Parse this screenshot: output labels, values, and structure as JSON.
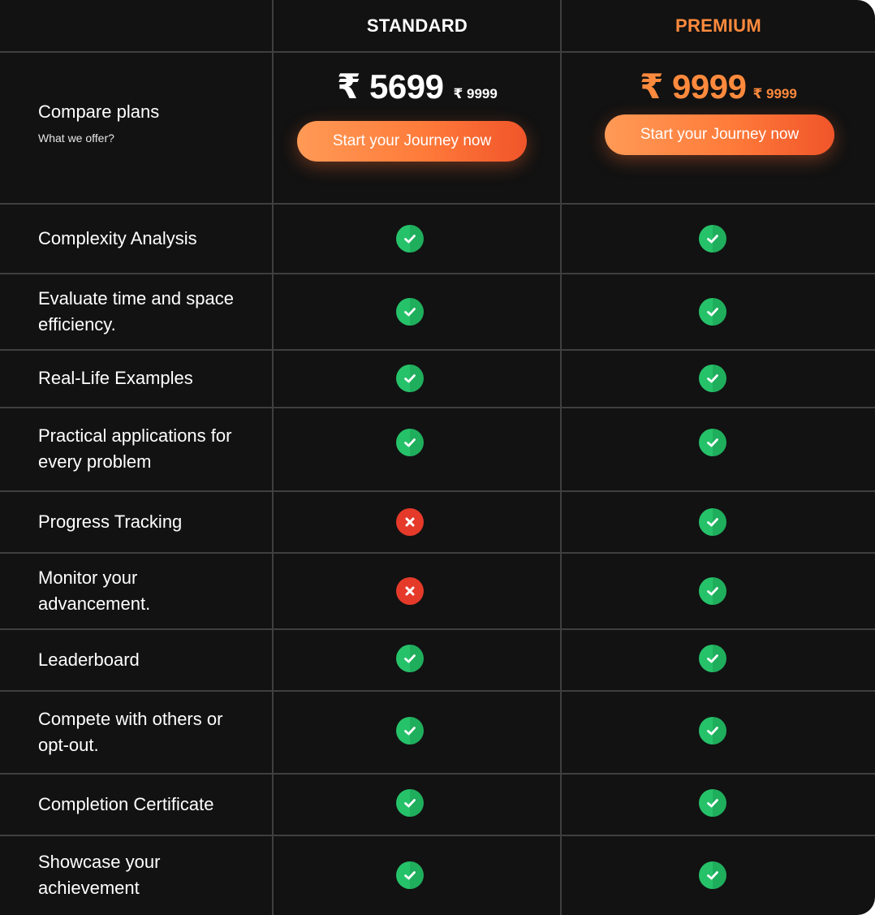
{
  "plans": {
    "standard": {
      "name": "STANDARD",
      "price": "₹ 5699",
      "original_price": "₹ 9999",
      "cta_label": "Start your Journey now"
    },
    "premium": {
      "name": "PREMIUM",
      "price": "₹ 9999",
      "original_price": "₹ 9999",
      "cta_label": "Start your Journey now"
    }
  },
  "compare": {
    "title": "Compare plans",
    "subtitle": "What we offer?"
  },
  "colors": {
    "background": "#121212",
    "grid_line": "#3f3f3f",
    "accent": "#ff8a3d",
    "check_green": "#26c26a",
    "cross_red": "#e53a2a"
  },
  "features": [
    {
      "label": "Complexity Analysis",
      "standard": "check-icon",
      "premium": "check-icon"
    },
    {
      "label": "Evaluate time and space efficiency.",
      "standard": "check-icon",
      "premium": "check-icon"
    },
    {
      "label": "Real-Life Examples",
      "standard": "check-icon",
      "premium": "check-icon"
    },
    {
      "label": "Practical applications for every problem",
      "standard": "check-icon",
      "premium": "check-icon"
    },
    {
      "label": "Progress Tracking",
      "standard": "cross-icon",
      "premium": "check-icon"
    },
    {
      "label": "Monitor your advancement.",
      "standard": "cross-icon",
      "premium": "check-icon"
    },
    {
      "label": "Leaderboard",
      "standard": "check-icon",
      "premium": "check-icon"
    },
    {
      "label": "Compete with others or opt-out.",
      "standard": "check-icon",
      "premium": "check-icon"
    },
    {
      "label": "Completion Certificate",
      "standard": "check-icon",
      "premium": "check-icon"
    },
    {
      "label": "Showcase your achievement",
      "standard": "check-icon",
      "premium": "check-icon"
    }
  ]
}
